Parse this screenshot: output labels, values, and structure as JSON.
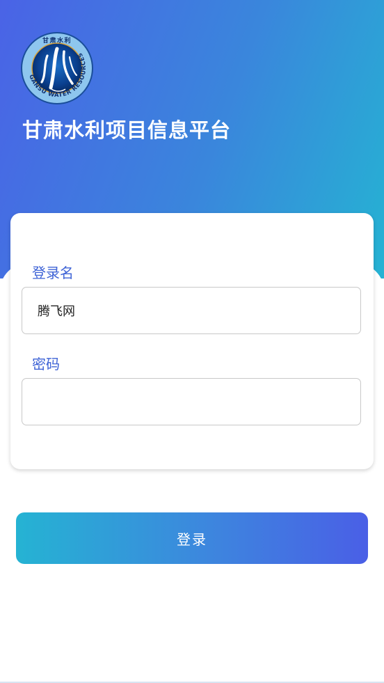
{
  "header": {
    "title": "甘肃水利项目信息平台",
    "logo": {
      "top_text": "甘肃水利",
      "ring_text": "GANSU WATER RESOURCES"
    }
  },
  "login_form": {
    "username_label": "登录名",
    "username_value": "腾飞网",
    "password_label": "密码",
    "password_value": ""
  },
  "actions": {
    "login_label": "登录"
  },
  "colors": {
    "accent_blue": "#3e63d6",
    "gradient_start": "#4a63e6",
    "gradient_end": "#25b3d3"
  }
}
